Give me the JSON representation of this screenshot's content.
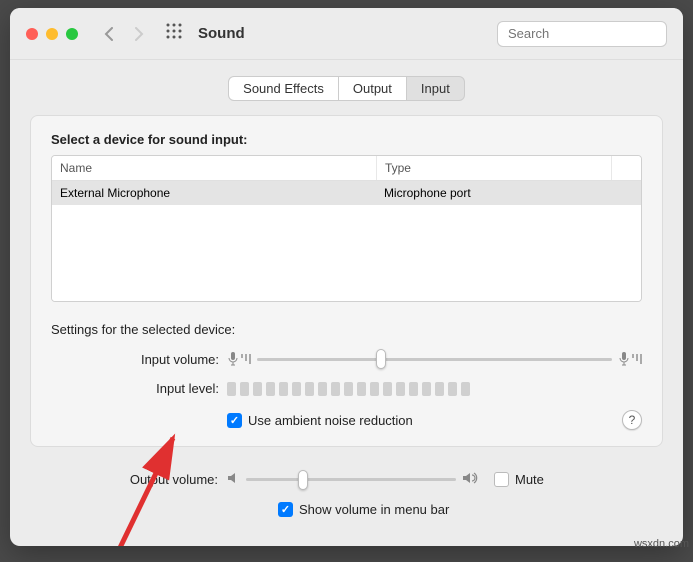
{
  "header": {
    "title": "Sound",
    "search_placeholder": "Search"
  },
  "tabs": {
    "sound_effects": "Sound Effects",
    "output": "Output",
    "input": "Input",
    "active": "input"
  },
  "input_panel": {
    "select_label": "Select a device for sound input:",
    "columns": {
      "name": "Name",
      "type": "Type"
    },
    "devices": [
      {
        "name": "External Microphone",
        "type": "Microphone port"
      }
    ],
    "settings_label": "Settings for the selected device:",
    "input_volume_label": "Input volume:",
    "input_volume_percent": 35,
    "input_level_label": "Input level:",
    "ambient_checked": true,
    "ambient_label": "Use ambient noise reduction",
    "help_label": "?"
  },
  "footer": {
    "output_volume_label": "Output volume:",
    "output_volume_percent": 27,
    "mute_checked": false,
    "mute_label": "Mute",
    "show_menu_checked": true,
    "show_menu_label": "Show volume in menu bar"
  },
  "watermark": "wsxdn.com"
}
